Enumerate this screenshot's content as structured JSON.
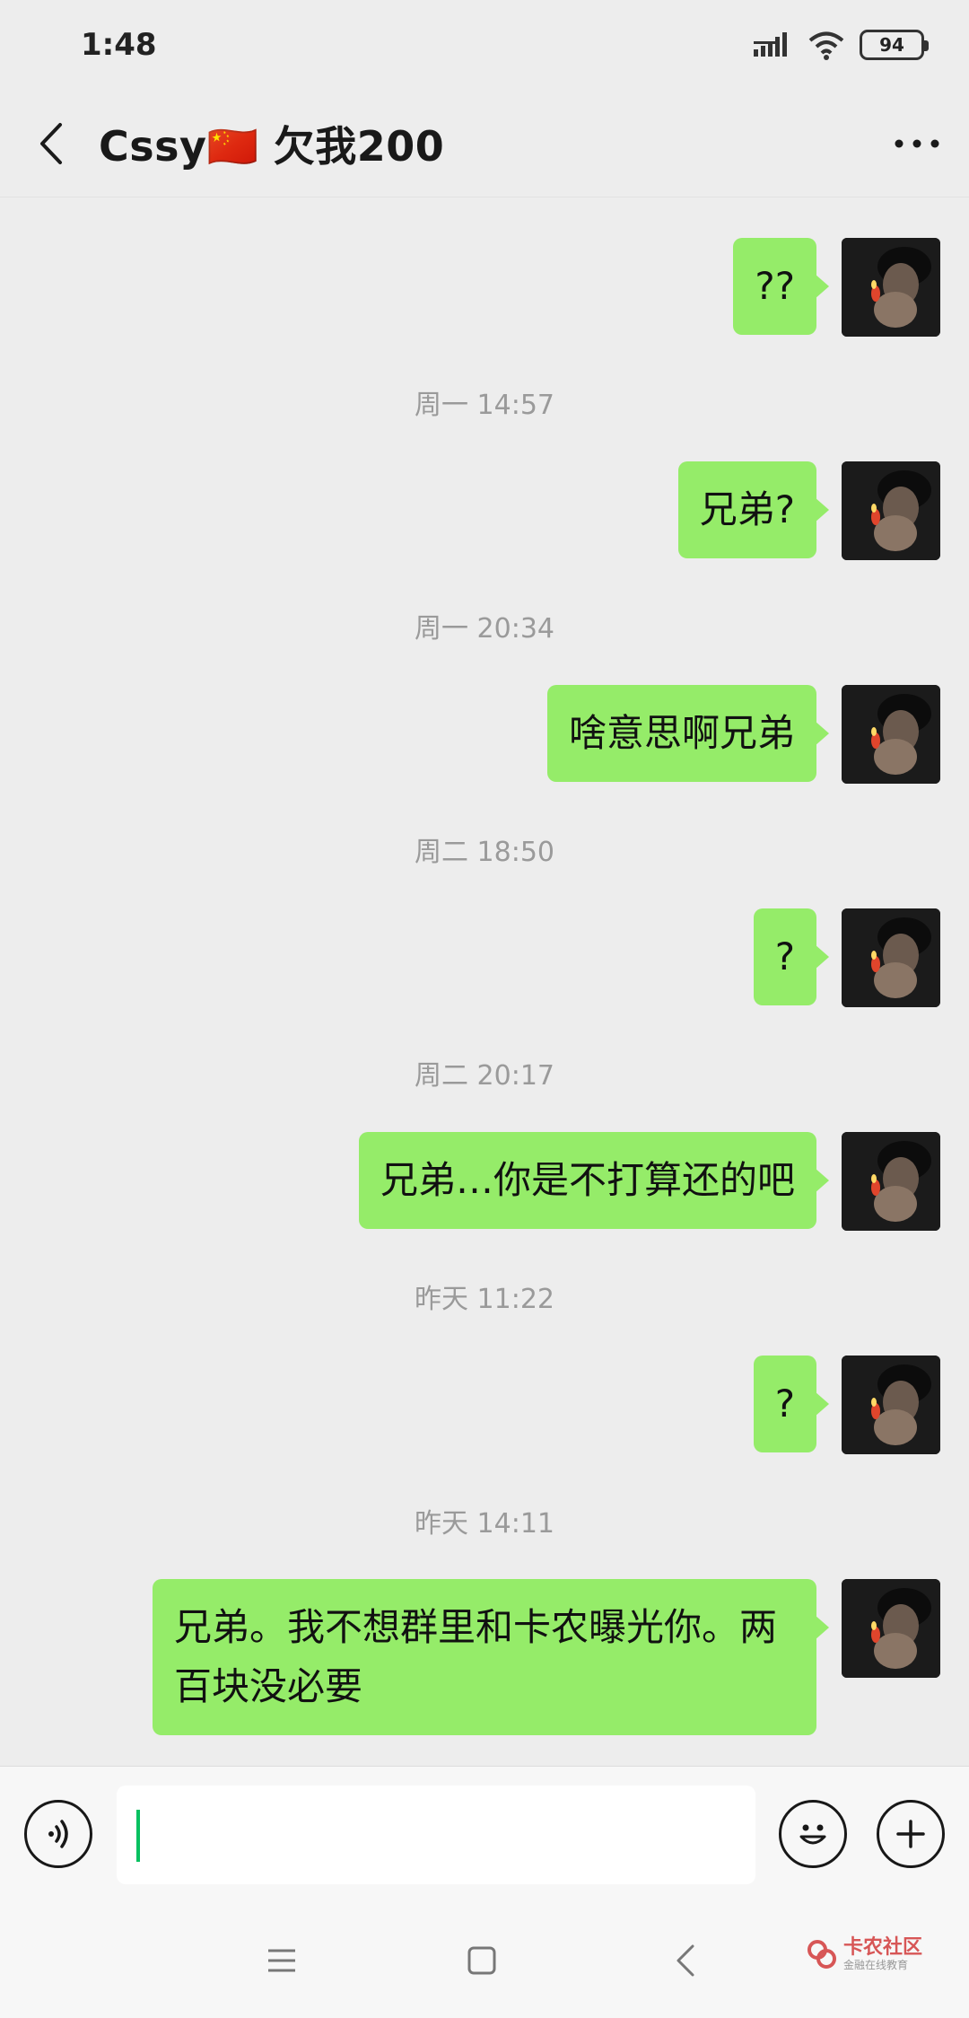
{
  "status_bar": {
    "time": "1:48",
    "battery": "94"
  },
  "header": {
    "title": "Cssy🇨🇳 欠我200"
  },
  "messages": [
    {
      "text": "??"
    },
    {
      "time": "周一 14:57"
    },
    {
      "text": "兄弟?"
    },
    {
      "time": "周一 20:34"
    },
    {
      "text": "啥意思啊兄弟"
    },
    {
      "time": "周二 18:50"
    },
    {
      "text": "?"
    },
    {
      "time": "周二 20:17"
    },
    {
      "text": "兄弟…你是不打算还的吧"
    },
    {
      "time": "昨天 11:22"
    },
    {
      "text": "?"
    },
    {
      "time": "昨天 14:11"
    },
    {
      "text": "兄弟。我不想群里和卡农曝光你。两百块没必要"
    }
  ],
  "input": {
    "value": ""
  },
  "watermark": {
    "title": "卡农社区",
    "subtitle": "金融在线教育"
  },
  "icons": {
    "back": "chevron-left-icon",
    "more": "more-dots-icon",
    "voice": "voice-icon",
    "emoji": "emoji-icon",
    "plus": "plus-icon",
    "signal": "signal-icon",
    "wifi": "wifi-icon",
    "menu": "menu-icon",
    "home": "home-icon",
    "nav_back": "nav-back-icon"
  },
  "colors": {
    "bubble": "#95ec69",
    "background": "#ededed",
    "accent": "#07c160",
    "timestamp": "#9a9a9a"
  }
}
